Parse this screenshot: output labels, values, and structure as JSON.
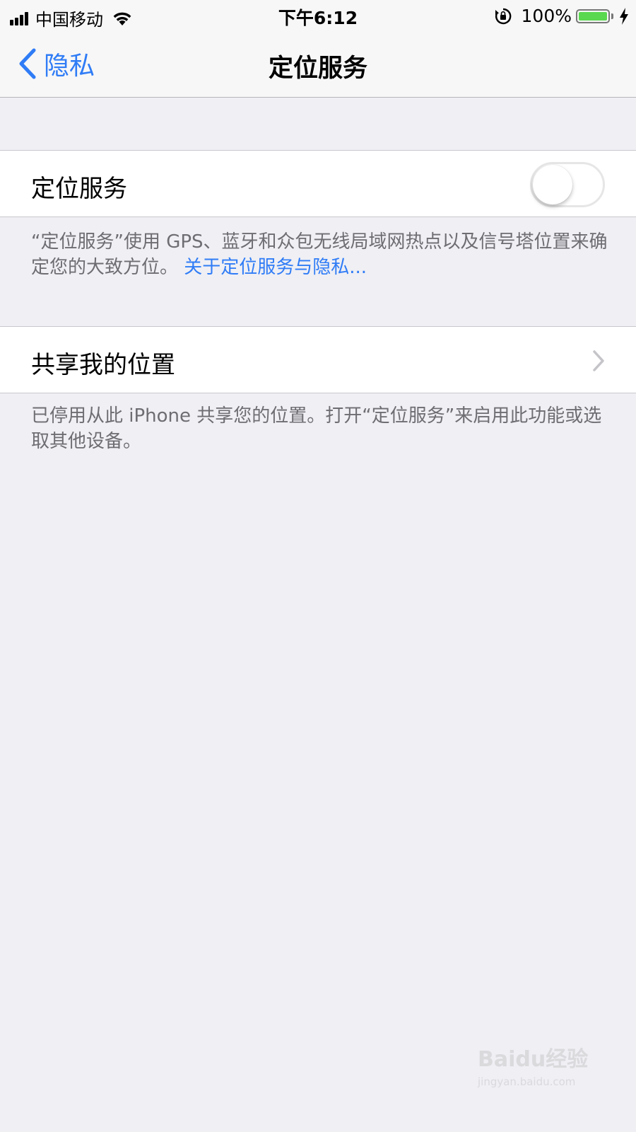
{
  "status_bar": {
    "carrier": "中国移动",
    "time": "下午6:12",
    "battery_percent": "100%",
    "battery_level": 1.0,
    "icons": [
      "signal-icon",
      "wifi-icon",
      "orientation-lock-icon",
      "battery-icon",
      "charging-icon"
    ]
  },
  "nav": {
    "back_label": "隐私",
    "title": "定位服务"
  },
  "location_services": {
    "label": "定位服务",
    "enabled": false,
    "description": "“定位服务”使用 GPS、蓝牙和众包无线局域网热点以及信号塔位置来确定您的大致方位。",
    "link_text": "关于定位服务与隐私..."
  },
  "share_location": {
    "label": "共享我的位置",
    "description": "已停用从此 iPhone 共享您的位置。打开“定位服务”来启用此功能或选取其他设备。"
  },
  "watermark": {
    "logo_text": "Baidu经验",
    "url": "jingyan.baidu.com"
  },
  "colors": {
    "accent": "#2f7cf6",
    "background": "#efeff4",
    "battery_fill": "#5ad84f",
    "footer_text": "#6d6d72"
  }
}
